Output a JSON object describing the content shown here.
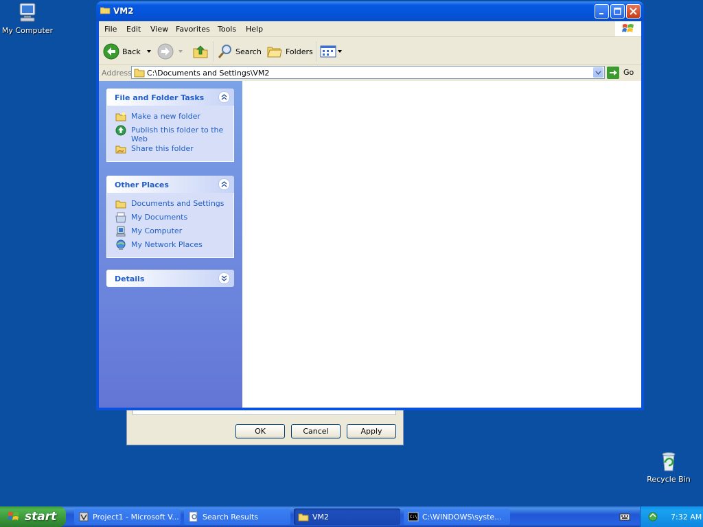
{
  "desktop": {
    "icons": [
      {
        "label": "My Computer"
      },
      {
        "label": "Recycle Bin"
      }
    ]
  },
  "dialog": {
    "buttons": {
      "ok": "OK",
      "cancel": "Cancel",
      "apply": "Apply"
    }
  },
  "window": {
    "title": "VM2",
    "menu": [
      "File",
      "Edit",
      "View",
      "Favorites",
      "Tools",
      "Help"
    ],
    "toolbar": {
      "back": "Back",
      "search": "Search",
      "folders": "Folders"
    },
    "address": {
      "label": "Address",
      "value": "C:\\Documents and Settings\\VM2",
      "go": "Go"
    },
    "tasks_panel": {
      "title": "File and Folder Tasks",
      "items": [
        "Make a new folder",
        "Publish this folder to the Web",
        "Share this folder"
      ]
    },
    "places_panel": {
      "title": "Other Places",
      "items": [
        "Documents and Settings",
        "My Documents",
        "My Computer",
        "My Network Places"
      ]
    },
    "details_panel": {
      "title": "Details"
    }
  },
  "taskbar": {
    "start": "start",
    "tasks": [
      "Project1 - Microsoft V...",
      "Search Results",
      "VM2",
      "C:\\WINDOWS\\syste..."
    ],
    "active_task": "VM2",
    "clock": "7:32 AM"
  },
  "colors": {
    "desktop": "#0b4fa3",
    "title_bar": "#0452d6",
    "task_link": "#215dc6",
    "start_button": "#3a963a"
  }
}
